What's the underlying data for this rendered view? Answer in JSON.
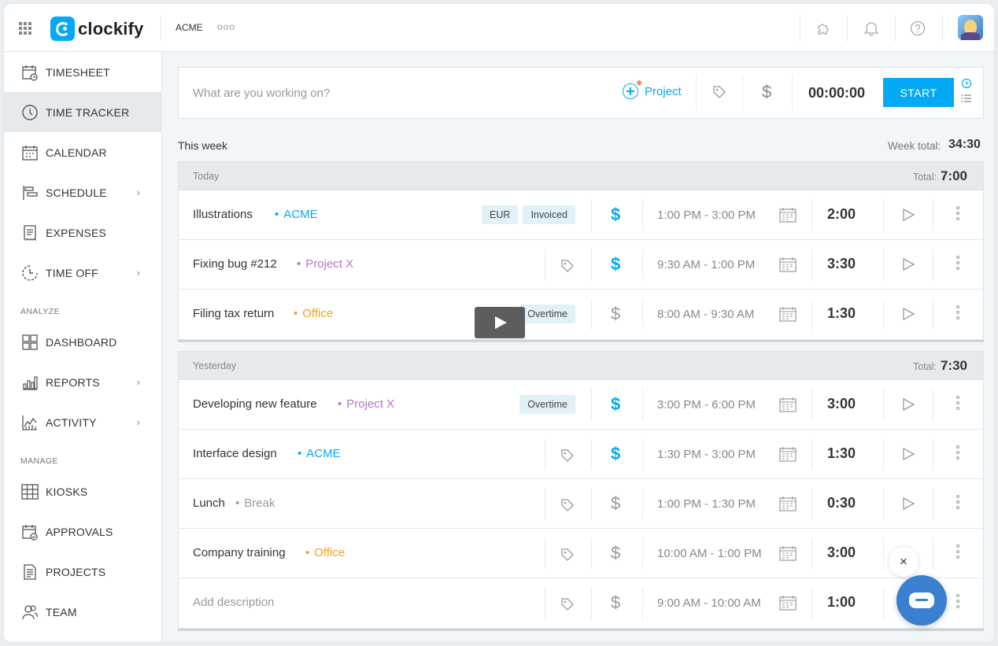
{
  "app": {
    "name": "clockify",
    "workspace": "ACME",
    "more": "ooo"
  },
  "icons": {
    "apps": "grid-icon",
    "integrations": "puzzle-icon",
    "notifications": "bell-icon",
    "help": "help-icon",
    "tag": "tag-icon",
    "billable": "dollar-icon",
    "calendar": "calendar-icon",
    "play": "play-icon",
    "more": "more-vertical-icon"
  },
  "colors": {
    "accent": "#03a9f4",
    "acme": "#03a9f4",
    "projectx": "#b873c8",
    "office": "#f0a21b",
    "break": "#999999"
  },
  "sidebar": {
    "items": [
      {
        "label": "TIMESHEET",
        "icon": "timesheet-icon",
        "active": false,
        "chevron": false
      },
      {
        "label": "TIME TRACKER",
        "icon": "clock-icon",
        "active": true,
        "chevron": false
      },
      {
        "label": "CALENDAR",
        "icon": "calendar-icon",
        "active": false,
        "chevron": false
      },
      {
        "label": "SCHEDULE",
        "icon": "schedule-icon",
        "active": false,
        "chevron": true
      },
      {
        "label": "EXPENSES",
        "icon": "receipt-icon",
        "active": false,
        "chevron": false
      },
      {
        "label": "TIME OFF",
        "icon": "time-off-icon",
        "active": false,
        "chevron": true
      }
    ],
    "analyze_label": "ANALYZE",
    "analyze_items": [
      {
        "label": "DASHBOARD",
        "icon": "dashboard-icon",
        "chevron": false
      },
      {
        "label": "REPORTS",
        "icon": "reports-icon",
        "chevron": true
      },
      {
        "label": "ACTIVITY",
        "icon": "activity-icon",
        "chevron": true
      }
    ],
    "manage_label": "MANAGE",
    "manage_items": [
      {
        "label": "KIOSKS",
        "icon": "kiosk-icon"
      },
      {
        "label": "APPROVALS",
        "icon": "approvals-icon"
      },
      {
        "label": "PROJECTS",
        "icon": "projects-icon"
      },
      {
        "label": "TEAM",
        "icon": "team-icon"
      }
    ]
  },
  "timer": {
    "placeholder": "What are you working on?",
    "project_label": "Project",
    "time": "00:00:00",
    "start_label": "START"
  },
  "week": {
    "label": "This week",
    "total_label": "Week total:",
    "total": "34:30"
  },
  "groups": [
    {
      "day": "Today",
      "total_label": "Total:",
      "total": "7:00",
      "entries": [
        {
          "description": "Illustrations",
          "project": "ACME",
          "project_color": "#03a9f4",
          "badges": [
            "EUR",
            "Invoiced"
          ],
          "billable": true,
          "range": "1:00 PM - 3:00 PM",
          "duration": "2:00"
        },
        {
          "description": "Fixing bug #212",
          "project": "Project X",
          "project_color": "#b873c8",
          "badges": [],
          "billable": true,
          "range": "9:30 AM - 1:00 PM",
          "duration": "3:30"
        },
        {
          "description": "Filing tax return",
          "project": "Office",
          "project_color": "#f0a21b",
          "badges": [
            "Overtime"
          ],
          "billable": false,
          "range": "8:00 AM - 9:30 AM",
          "duration": "1:30"
        }
      ]
    },
    {
      "day": "Yesterday",
      "total_label": "Total:",
      "total": "7:30",
      "entries": [
        {
          "description": "Developing new feature",
          "project": "Project X",
          "project_color": "#b873c8",
          "badges": [
            "Overtime"
          ],
          "billable": true,
          "range": "3:00 PM - 6:00 PM",
          "duration": "3:00"
        },
        {
          "description": "Interface design",
          "project": "ACME",
          "project_color": "#03a9f4",
          "badges": [],
          "billable": true,
          "range": "1:30 PM - 3:00 PM",
          "duration": "1:30"
        },
        {
          "description": "Lunch",
          "project": "Break",
          "project_color": "#999999",
          "badges": [],
          "billable": false,
          "range": "1:00 PM - 1:30 PM",
          "duration": "0:30"
        },
        {
          "description": "Company training",
          "project": "Office",
          "project_color": "#f0a21b",
          "badges": [],
          "billable": false,
          "range": "10:00 AM - 1:00 PM",
          "duration": "3:00"
        },
        {
          "description": "Add description",
          "empty": true,
          "project": "",
          "project_color": "",
          "badges": [],
          "billable": false,
          "range": "9:00 AM - 10:00 AM",
          "duration": "1:00"
        }
      ]
    }
  ],
  "chat": {
    "close": "×"
  }
}
